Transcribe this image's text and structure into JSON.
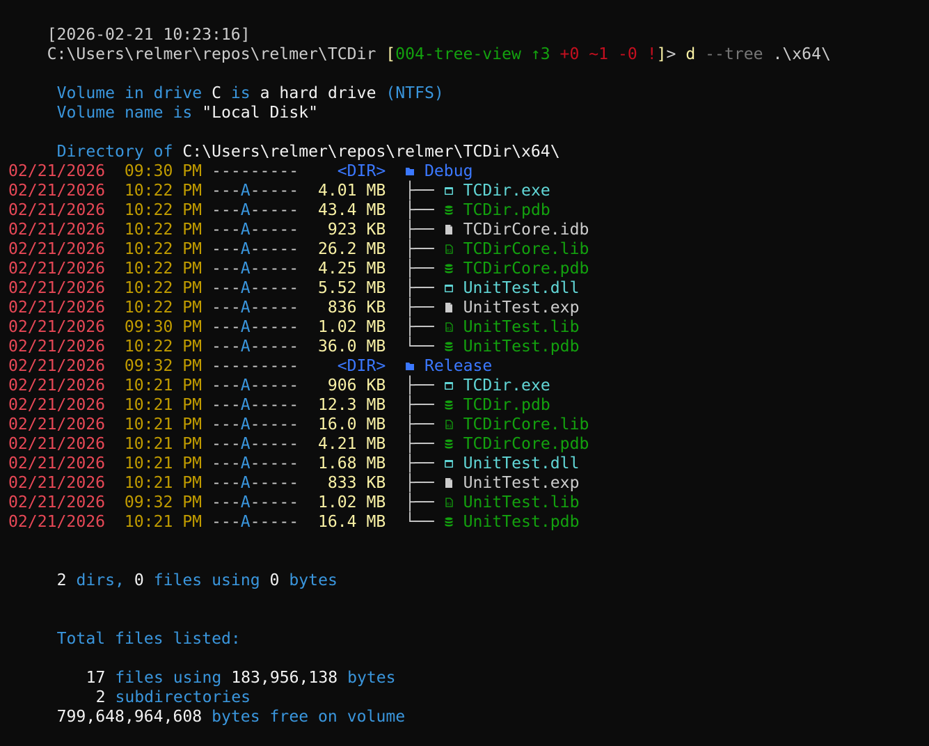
{
  "terminal": {
    "timestamp": "[2026-02-21 10:23:16]",
    "prompt": {
      "path": "C:\\Users\\relmer\\repos\\relmer\\TCDir",
      "git_open": "[",
      "branch": "004-tree-view",
      "ahead": "↑3",
      "plus": "+0",
      "tilde": "~1",
      "minus": "-0",
      "bang": "!",
      "git_close": "]",
      "arrow": ">",
      "command": "d",
      "flag": "--tree",
      "arg": ".\\x64\\"
    },
    "volume": {
      "line1_a": "Volume in drive",
      "line1_drive": "C",
      "line1_b": "is",
      "line1_c": "a hard drive",
      "line1_d": "(NTFS)",
      "line2_a": "Volume name is",
      "line2_name": "\"Local Disk\""
    },
    "directory": {
      "label": "Directory of",
      "path": "C:\\Users\\relmer\\repos\\relmer\\TCDir\\x64\\"
    },
    "rows": [
      {
        "date": "02/21/2026",
        "time": "09:30 PM",
        "attr": "---------",
        "size": "<DIR>",
        "name": "Debug",
        "kind": "dir"
      },
      {
        "date": "02/21/2026",
        "time": "10:22 PM",
        "attr": "---A-----",
        "size": "4.01 MB",
        "tree": "├──",
        "name": "TCDir.exe",
        "kind": "exe"
      },
      {
        "date": "02/21/2026",
        "time": "10:22 PM",
        "attr": "---A-----",
        "size": "43.4 MB",
        "tree": "├──",
        "name": "TCDir.pdb",
        "kind": "pdb"
      },
      {
        "date": "02/21/2026",
        "time": "10:22 PM",
        "attr": "---A-----",
        "size": "923 KB",
        "tree": "├──",
        "name": "TCDirCore.idb",
        "kind": "plain"
      },
      {
        "date": "02/21/2026",
        "time": "10:22 PM",
        "attr": "---A-----",
        "size": "26.2 MB",
        "tree": "├──",
        "name": "TCDirCore.lib",
        "kind": "lib"
      },
      {
        "date": "02/21/2026",
        "time": "10:22 PM",
        "attr": "---A-----",
        "size": "4.25 MB",
        "tree": "├──",
        "name": "TCDirCore.pdb",
        "kind": "pdb"
      },
      {
        "date": "02/21/2026",
        "time": "10:22 PM",
        "attr": "---A-----",
        "size": "5.52 MB",
        "tree": "├──",
        "name": "UnitTest.dll",
        "kind": "exe"
      },
      {
        "date": "02/21/2026",
        "time": "10:22 PM",
        "attr": "---A-----",
        "size": "836 KB",
        "tree": "├──",
        "name": "UnitTest.exp",
        "kind": "plain"
      },
      {
        "date": "02/21/2026",
        "time": "09:30 PM",
        "attr": "---A-----",
        "size": "1.02 MB",
        "tree": "├──",
        "name": "UnitTest.lib",
        "kind": "lib"
      },
      {
        "date": "02/21/2026",
        "time": "10:22 PM",
        "attr": "---A-----",
        "size": "36.0 MB",
        "tree": "└──",
        "name": "UnitTest.pdb",
        "kind": "pdb"
      },
      {
        "date": "02/21/2026",
        "time": "09:32 PM",
        "attr": "---------",
        "size": "<DIR>",
        "name": "Release",
        "kind": "dir"
      },
      {
        "date": "02/21/2026",
        "time": "10:21 PM",
        "attr": "---A-----",
        "size": "906 KB",
        "tree": "├──",
        "name": "TCDir.exe",
        "kind": "exe"
      },
      {
        "date": "02/21/2026",
        "time": "10:21 PM",
        "attr": "---A-----",
        "size": "12.3 MB",
        "tree": "├──",
        "name": "TCDir.pdb",
        "kind": "pdb"
      },
      {
        "date": "02/21/2026",
        "time": "10:21 PM",
        "attr": "---A-----",
        "size": "16.0 MB",
        "tree": "├──",
        "name": "TCDirCore.lib",
        "kind": "lib"
      },
      {
        "date": "02/21/2026",
        "time": "10:21 PM",
        "attr": "---A-----",
        "size": "4.21 MB",
        "tree": "├──",
        "name": "TCDirCore.pdb",
        "kind": "pdb"
      },
      {
        "date": "02/21/2026",
        "time": "10:21 PM",
        "attr": "---A-----",
        "size": "1.68 MB",
        "tree": "├──",
        "name": "UnitTest.dll",
        "kind": "exe"
      },
      {
        "date": "02/21/2026",
        "time": "10:21 PM",
        "attr": "---A-----",
        "size": "833 KB",
        "tree": "├──",
        "name": "UnitTest.exp",
        "kind": "plain"
      },
      {
        "date": "02/21/2026",
        "time": "09:32 PM",
        "attr": "---A-----",
        "size": "1.02 MB",
        "tree": "├──",
        "name": "UnitTest.lib",
        "kind": "lib"
      },
      {
        "date": "02/21/2026",
        "time": "10:21 PM",
        "attr": "---A-----",
        "size": "16.4 MB",
        "tree": "└──",
        "name": "UnitTest.pdb",
        "kind": "pdb"
      }
    ],
    "summary": {
      "dirs_n": "2",
      "dirs_label": "dirs,",
      "files_n": "0",
      "files_label": "files using",
      "bytes_n": "0",
      "bytes_label": "bytes"
    },
    "totals": {
      "header": "Total files listed:",
      "files_n": "17",
      "files_label": "files using",
      "bytes_n": "183,956,138",
      "bytes_label": "bytes",
      "subdirs_n": "2",
      "subdirs_label": "subdirectories",
      "free_n": "799,648,964,608",
      "free_label": "bytes free on volume"
    },
    "colors": {
      "background": "#0c0c0c",
      "date": "#e74856",
      "time": "#c19c00",
      "label_blue": "#3a96dd",
      "dir_blue": "#3b78ff",
      "size": "#f9f1a5",
      "exe_cyan": "#61d6d6",
      "pdb_lib_green": "#13a10e"
    },
    "icons": {
      "dir": "folder-icon",
      "exe": "window-app-icon",
      "pdb": "database-icon",
      "lib": "library-icon",
      "plain": "file-icon"
    }
  }
}
